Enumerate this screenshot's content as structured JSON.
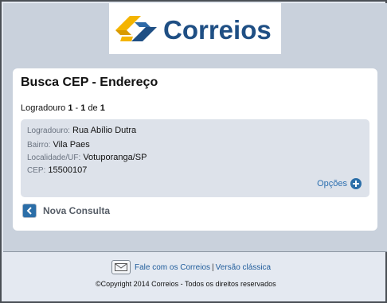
{
  "brand": {
    "logo_text": "Correios",
    "colors": {
      "yellow": "#f4b400",
      "blue": "#1f4f84"
    }
  },
  "card": {
    "title": "Busca CEP - Endereço",
    "count": {
      "label": "Logradouro",
      "from": "1",
      "sep1": " - ",
      "to": "1",
      "de": "de",
      "total": "1"
    }
  },
  "result": {
    "logradouro_label": "Logradouro:",
    "logradouro_value": "Rua Abílio Dutra",
    "bairro_label": "Bairro:",
    "bairro_value": "Vila Paes",
    "localidade_label": "Localidade/UF:",
    "localidade_value": "Votuporanga/SP",
    "cep_label": "CEP:",
    "cep_value": "15500107",
    "options_label": "Opções"
  },
  "actions": {
    "new_search": "Nova Consulta"
  },
  "footer": {
    "contact_link": "Fale com os Correios",
    "separator": "|",
    "classic_link": "Versão clássica",
    "copyright": "©Copyright 2014 Correios - Todos os direitos reservados"
  }
}
